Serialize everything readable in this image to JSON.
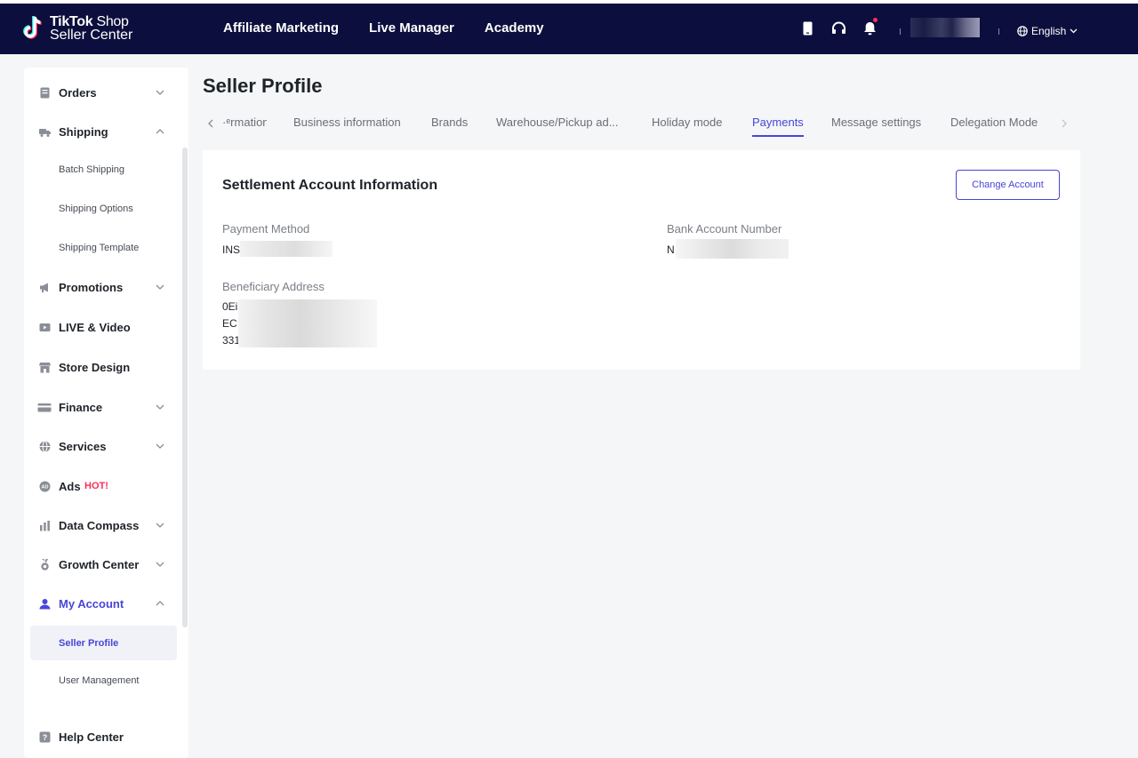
{
  "brand": {
    "line1_bold": "TikTok",
    "line1_rest": " Shop",
    "line2": "Seller Center"
  },
  "topnav": [
    "Affiliate Marketing",
    "Live Manager",
    "Academy"
  ],
  "topbar": {
    "language": "English",
    "icons": [
      "mobile-icon",
      "headset-icon",
      "bell-icon"
    ]
  },
  "sidebar": {
    "items": [
      {
        "label": "Orders",
        "icon": "orders-icon",
        "expanded": false
      },
      {
        "label": "Shipping",
        "icon": "truck-icon",
        "expanded": true,
        "children": [
          "Batch Shipping",
          "Shipping Options",
          "Shipping Template"
        ]
      },
      {
        "label": "Promotions",
        "icon": "megaphone-icon",
        "expanded": false
      },
      {
        "label": "LIVE & Video",
        "icon": "video-icon"
      },
      {
        "label": "Store Design",
        "icon": "store-icon"
      },
      {
        "label": "Finance",
        "icon": "card-icon",
        "expanded": false
      },
      {
        "label": "Services",
        "icon": "globe-icon",
        "expanded": false
      },
      {
        "label": "Ads",
        "icon": "ad-icon",
        "badge": "HOT!"
      },
      {
        "label": "Data Compass",
        "icon": "bar-chart-icon",
        "expanded": false
      },
      {
        "label": "Growth Center",
        "icon": "medal-icon",
        "expanded": false
      },
      {
        "label": "My Account",
        "icon": "user-icon",
        "expanded": true,
        "active": true,
        "children": [
          "Seller Profile",
          "User Management"
        ],
        "active_child": "Seller Profile"
      },
      {
        "label": "Help Center",
        "icon": "help-icon"
      }
    ]
  },
  "main": {
    "title": "Seller Profile",
    "tabs": [
      "ᵉrmation",
      "Business information",
      "Brands",
      "Warehouse/Pickup ad...",
      "Holiday mode",
      "Payments",
      "Message settings",
      "Delegation Mode"
    ],
    "active_tab": "Payments",
    "card": {
      "title": "Settlement Account Information",
      "button": "Change Account",
      "payment_method_label": "Payment Method",
      "payment_method_value": "INS",
      "bank_account_label": "Bank Account Number",
      "bank_account_value": "N",
      "beneficiary_label": "Beneficiary Address",
      "beneficiary_lines": [
        "0Ei",
        "EC",
        "331"
      ]
    }
  },
  "colors": {
    "topbar": "#0c0f3d",
    "accent": "#4845d8",
    "hot": "#fe2c55"
  }
}
